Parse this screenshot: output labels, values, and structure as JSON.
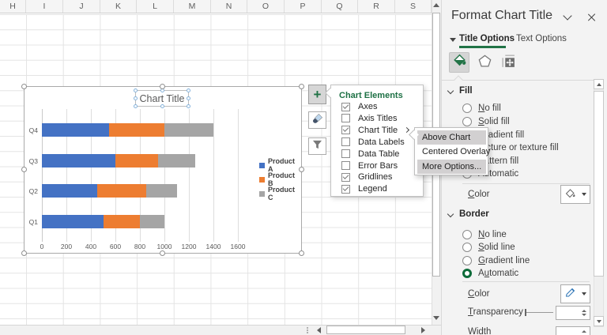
{
  "spreadsheet": {
    "column_headers": [
      "H",
      "I",
      "J",
      "K",
      "L",
      "M",
      "N",
      "O",
      "P",
      "Q",
      "R",
      "S"
    ]
  },
  "chart_data": {
    "type": "bar",
    "orientation": "horizontal",
    "stacked": true,
    "title": "Chart Title",
    "categories": [
      "Q1",
      "Q2",
      "Q3",
      "Q4"
    ],
    "series": [
      {
        "name": "Product A",
        "color": "#4472C4",
        "values": [
          500,
          450,
          600,
          550
        ]
      },
      {
        "name": "Product B",
        "color": "#ED7D31",
        "values": [
          300,
          400,
          350,
          450
        ]
      },
      {
        "name": "Product C",
        "color": "#A5A5A5",
        "values": [
          200,
          250,
          300,
          400
        ]
      }
    ],
    "xlim": [
      0,
      1600
    ],
    "x_ticks": [
      "0",
      "200",
      "400",
      "600",
      "800",
      "1000",
      "1200",
      "1400",
      "1600"
    ],
    "legend_position": "right",
    "gridlines": true
  },
  "chart_tools": {
    "add_button_glyph": "+",
    "icons": [
      "plus-icon",
      "brush-icon",
      "funnel-icon"
    ]
  },
  "chart_elements_popup": {
    "title": "Chart Elements",
    "items": [
      {
        "label": "Axes",
        "checked": true,
        "has_submenu": false
      },
      {
        "label": "Axis Titles",
        "checked": false,
        "has_submenu": false
      },
      {
        "label": "Chart Title",
        "checked": true,
        "has_submenu": true
      },
      {
        "label": "Data Labels",
        "checked": false,
        "has_submenu": false
      },
      {
        "label": "Data Table",
        "checked": false,
        "has_submenu": false
      },
      {
        "label": "Error Bars",
        "checked": false,
        "has_submenu": false
      },
      {
        "label": "Gridlines",
        "checked": true,
        "has_submenu": false
      },
      {
        "label": "Legend",
        "checked": true,
        "has_submenu": false
      }
    ]
  },
  "title_submenu": {
    "items": [
      {
        "label": "Above Chart",
        "highlighted": true
      },
      {
        "label": "Centered Overlay",
        "highlighted": false
      },
      {
        "label": "More Options...",
        "highlighted": true
      }
    ]
  },
  "format_pane": {
    "title": "Format Chart Title",
    "tabs": [
      {
        "label": "Title Options",
        "active": true
      },
      {
        "label": "Text Options",
        "active": false
      }
    ],
    "icon_buttons": [
      "fill-line-bucket-icon",
      "effects-pentagon-icon",
      "size-properties-icon"
    ],
    "fill": {
      "section_title": "Fill",
      "options": [
        {
          "label": "No fill",
          "underline": "N",
          "selected": false
        },
        {
          "label": "Solid fill",
          "underline": "S",
          "selected": false
        },
        {
          "label": "Gradient fill",
          "underline": "",
          "selected": false
        },
        {
          "label": "Picture or texture fill",
          "underline": "",
          "selected": false
        },
        {
          "label": "Pattern fill",
          "underline": "",
          "selected": false
        },
        {
          "label": "Automatic",
          "underline": "",
          "selected": false
        }
      ],
      "color_label": {
        "label": "Color",
        "underline": "C"
      }
    },
    "border": {
      "section_title": "Border",
      "options": [
        {
          "label": "No line",
          "underline": "N",
          "selected": false
        },
        {
          "label": "Solid line",
          "underline": "S",
          "selected": false
        },
        {
          "label": "Gradient line",
          "underline": "G",
          "selected": false
        },
        {
          "label": "Automatic",
          "underline": "u",
          "selected": true
        }
      ],
      "color_label": {
        "label": "Color",
        "underline": "C"
      },
      "transparency_label": {
        "label": "Transparency",
        "underline": "T"
      },
      "width_label": {
        "label": "Width",
        "underline": ""
      }
    }
  },
  "colors": {
    "excel_green": "#217346",
    "series_blue": "#4472C4",
    "series_orange": "#ED7D31",
    "series_gray": "#A5A5A5",
    "menu_highlight": "#D2D0D1"
  }
}
